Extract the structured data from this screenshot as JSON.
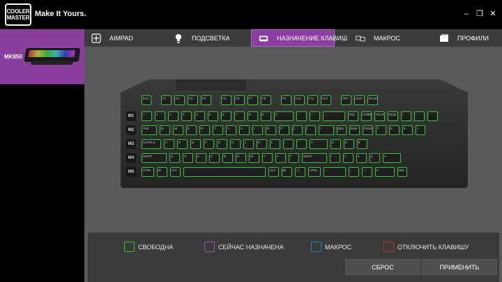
{
  "brand": {
    "logo_line1": "COOLER",
    "logo_line2": "MASTER",
    "slogan": "Make It Yours."
  },
  "window": {
    "minimize": "‒",
    "maximize": "❐",
    "close": "✕"
  },
  "device": {
    "name": "MK850"
  },
  "tabs": [
    {
      "label": "AIMPAD",
      "icon": "aimpad-icon"
    },
    {
      "label": "ПОДСВЕТКА",
      "icon": "lighting-icon"
    },
    {
      "label": "НАЗНАЧЕНИЕ КЛАВИШ",
      "icon": "keyboard-icon"
    },
    {
      "label": "МАКРОС",
      "icon": "macro-icon"
    },
    {
      "label": "ПРОФИЛИ",
      "icon": "profiles-icon"
    }
  ],
  "active_tab": 2,
  "keyboard": {
    "macro_keys": [
      "M1",
      "M2",
      "M3",
      "M4",
      "M5"
    ],
    "rows": [
      [
        "ESC",
        "F1",
        "F2",
        "F3",
        "F4",
        "F5",
        "F6",
        "F7",
        "F8",
        "F9",
        "F10",
        "F11",
        "F12",
        "PRT",
        "SCR",
        "PAUSE"
      ],
      [
        "~",
        "1",
        "2",
        "3",
        "4",
        "5",
        "6",
        "7",
        "8",
        "9",
        "0",
        "-",
        "=",
        "←",
        "INS",
        "HOME",
        "PGUP",
        "NUM",
        "/",
        "*",
        "-"
      ],
      [
        "TAB",
        "Q",
        "W",
        "E",
        "R",
        "T",
        "Y",
        "U",
        "I",
        "O",
        "P",
        "[",
        "]",
        "\\",
        "DEL",
        "END",
        "PGDN",
        "7",
        "8",
        "9",
        "+"
      ],
      [
        "CAPSLK",
        "A",
        "S",
        "D",
        "F",
        "G",
        "H",
        "J",
        "K",
        "L",
        ";",
        "'",
        "↵",
        "4",
        "5",
        "6"
      ],
      [
        "SHIFT",
        "Z",
        "X",
        "C",
        "V",
        "B",
        "N",
        "M",
        "<",
        ">",
        "?",
        "SHIFT",
        "↑",
        "1",
        "2",
        "3",
        "↵"
      ],
      [
        "CTRL",
        "⊞",
        "ALT",
        "",
        "ALT",
        "⊞",
        "◯",
        "CTRL",
        "←",
        "↓",
        "→",
        "0",
        "DEL"
      ]
    ]
  },
  "legend": {
    "free": "СВОБОДНА",
    "assigned": "СЕЙЧАС НАЗНАЧЕНА",
    "macro": "МАКРОС",
    "disable": "ОТКЛЮЧИТЬ КЛАВИШУ"
  },
  "colors": {
    "free": "#32c832",
    "assigned": "#9a5ab0",
    "macro": "#2a7ab8",
    "disable": "#c42a2a",
    "accent": "#8a3fa0"
  },
  "buttons": {
    "reset": "СБРОС",
    "apply": "ПРИМЕНИТЬ"
  }
}
